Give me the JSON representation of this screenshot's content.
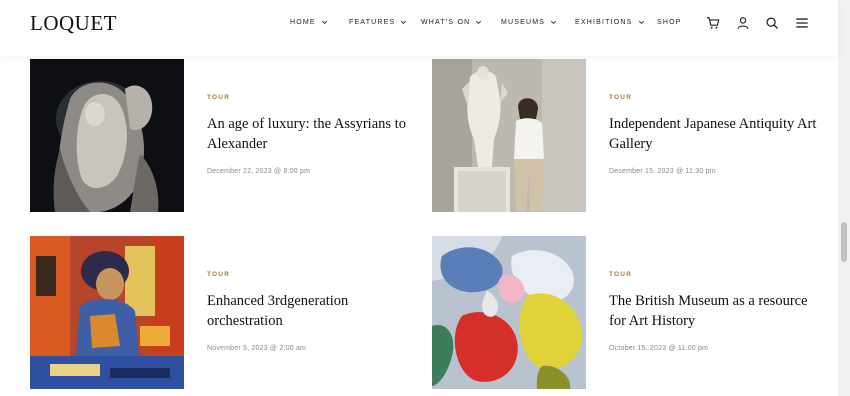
{
  "brand": {
    "logo": "LOQUET"
  },
  "nav": [
    {
      "label": "HOME"
    },
    {
      "label": "FEATURES"
    },
    {
      "label": "WHAT'S ON"
    },
    {
      "label": "MUSEUMS"
    },
    {
      "label": "EXHIBITIONS"
    },
    {
      "label": "SHOP"
    }
  ],
  "header_icons": [
    "cart-icon",
    "user-icon",
    "search-icon",
    "menu-icon"
  ],
  "posts": [
    {
      "tag": "TOUR",
      "title": "An age of luxury: the Assyrians to Alexander",
      "date": "December 22, 2023 @ 8:00 pm",
      "image": "marble-sculpture-image"
    },
    {
      "tag": "TOUR",
      "title": "Independent Japanese Antiquity Art Gallery",
      "date": "December 15, 2023 @ 11:30 pm",
      "image": "torso-statue-visitor-image"
    },
    {
      "tag": "TOUR",
      "title": "Enhanced 3rdgeneration orchestration",
      "date": "November 5, 2023 @ 2:00 am",
      "image": "expressionist-portrait-painting-image"
    },
    {
      "tag": "TOUR",
      "title": "The British Museum as a resource for Art History",
      "date": "October 15, 2023 @ 11:00 pm",
      "image": "paint-palette-image"
    }
  ],
  "colors": {
    "accent": "#a57c3b",
    "text": "#111111",
    "muted": "#8a8a8a"
  }
}
